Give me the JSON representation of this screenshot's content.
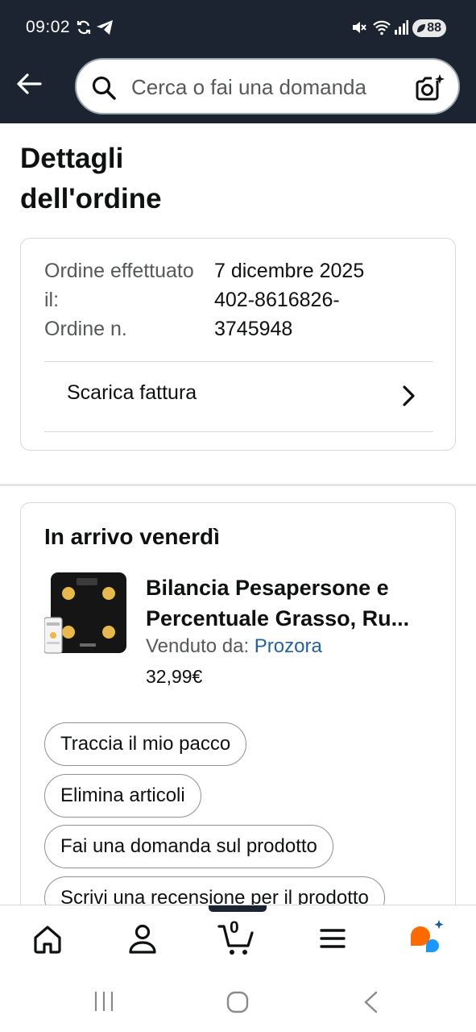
{
  "status_bar": {
    "time": "09:02",
    "battery": "88"
  },
  "header": {
    "search_placeholder": "Cerca o fai una domanda",
    "accent": "#1b2430"
  },
  "page": {
    "title": "Dettagli dell'ordine"
  },
  "order_info": {
    "date_label": "Ordine effettuato il:",
    "date_value": "7 dicembre 2025",
    "number_label": "Ordine n.",
    "number_value": "402-8616826-3745948",
    "invoice_label": "Scarica fattura"
  },
  "shipment": {
    "arrival": "In arrivo venerdì",
    "product_title": "Bilancia Pesapersone e Percentuale Grasso, Ru...",
    "sold_by_label": "Venduto da:",
    "seller": "Prozora",
    "price": "32,99€",
    "actions": [
      "Traccia il mio pacco",
      "Elimina articoli",
      "Fai una domanda sul prodotto",
      "Scrivi una recensione per il prodotto"
    ]
  },
  "bottom_nav": {
    "cart_count": "0",
    "items": [
      "home-icon",
      "account-icon",
      "cart-icon",
      "menu-icon",
      "rufus-icon"
    ]
  },
  "colors": {
    "link": "#2162a1",
    "rufus_orange": "#ff6a00",
    "rufus_blue": "#1a98ff"
  }
}
